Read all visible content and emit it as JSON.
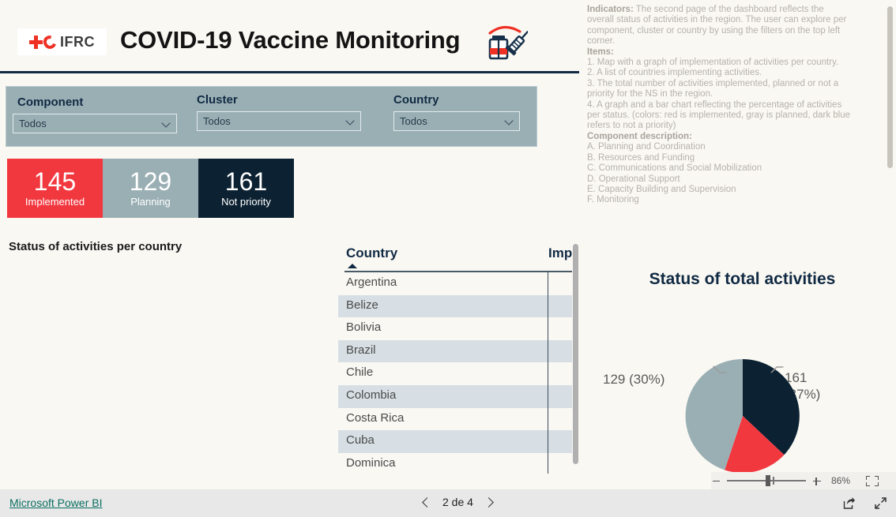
{
  "header": {
    "logo_text": "IFRC",
    "title": "COVID-19 Vaccine Monitoring",
    "vaccine_icon": "vaccine-vial-syringe-icon"
  },
  "filters": [
    {
      "label": "Component",
      "value": "Todos"
    },
    {
      "label": "Cluster",
      "value": "Todos"
    },
    {
      "label": "Country",
      "value": "Todos"
    }
  ],
  "kpis": [
    {
      "value": "145",
      "label": "Implemented",
      "color": "#f2383f"
    },
    {
      "value": "129",
      "label": "Planning",
      "color": "#9aafb4"
    },
    {
      "value": "161",
      "label": "Not priority",
      "color": "#0c2233"
    }
  ],
  "section": {
    "activities_heading": "Status of activities per country"
  },
  "table": {
    "columns": [
      "Country",
      "Imp"
    ],
    "sort_column": "Country",
    "sort_direction": "ascending",
    "rows": [
      {
        "country": "Argentina"
      },
      {
        "country": "Belize"
      },
      {
        "country": "Bolivia"
      },
      {
        "country": "Brazil"
      },
      {
        "country": "Chile"
      },
      {
        "country": "Colombia"
      },
      {
        "country": "Costa Rica"
      },
      {
        "country": "Cuba"
      },
      {
        "country": "Dominica"
      }
    ]
  },
  "info_panel": {
    "lines": [
      {
        "bold": "Indicators:",
        "text": " The second page of the dashboard reflects the"
      },
      {
        "bold": "",
        "text": "overall status of activities in the region. The user can explore per"
      },
      {
        "bold": "",
        "text": "component, cluster or country by using the filters on the top left"
      },
      {
        "bold": "",
        "text": "corner."
      },
      {
        "bold": "Items:",
        "text": ""
      },
      {
        "bold": "",
        "text": "1. Map with a graph of implementation of activities per country."
      },
      {
        "bold": "",
        "text": "2. A list of countries implementing activities."
      },
      {
        "bold": "",
        "text": "3. The total number of activities implemented, planned or not a"
      },
      {
        "bold": "",
        "text": "priority for the NS in the region."
      },
      {
        "bold": "",
        "text": "4. A graph and a bar chart reflecting the percentage of activities"
      },
      {
        "bold": "",
        "text": "per status. (colors: red is implemented, gray is planned, dark blue"
      },
      {
        "bold": "",
        "text": "refers to not a priority)"
      },
      {
        "bold": "Component description:",
        "text": ""
      },
      {
        "bold": "",
        "text": "A. Planning and Coordination"
      },
      {
        "bold": "",
        "text": "B. Resources and Funding"
      },
      {
        "bold": "",
        "text": "C. Communications and Social Mobilization"
      },
      {
        "bold": "",
        "text": "D. Operational Support"
      },
      {
        "bold": "",
        "text": "E. Capacity Building and Supervision"
      },
      {
        "bold": "",
        "text": "F. Monitoring"
      }
    ]
  },
  "chart_data": {
    "type": "pie",
    "title": "Status of total activities",
    "categories": [
      "Not priority",
      "Planning",
      "Implemented"
    ],
    "values": [
      161,
      129,
      145
    ],
    "percentages": [
      37,
      30,
      33
    ],
    "colors": [
      "#0c2233",
      "#9aafb4",
      "#f2383f"
    ],
    "labels": [
      "161\n(37%)",
      "129 (30%)",
      ""
    ],
    "label_notpriority": "161",
    "label_notpriority_pct": "(37%)",
    "label_planning": "129 (30%)",
    "legend": "none",
    "note": "pie clipped by viewport bottom; implemented red slice only partially visible"
  },
  "zoom_bar": {
    "value": "86%",
    "minus": "-",
    "plus": "+",
    "fit_icon": "fit-to-page-icon"
  },
  "bottom_bar": {
    "powerbi_label": "Microsoft Power BI",
    "page_indicator": "2 de 4",
    "prev_icon": "chevron-left-icon",
    "next_icon": "chevron-right-icon",
    "share_icon": "share-icon",
    "fullscreen_icon": "fullscreen-icon"
  }
}
